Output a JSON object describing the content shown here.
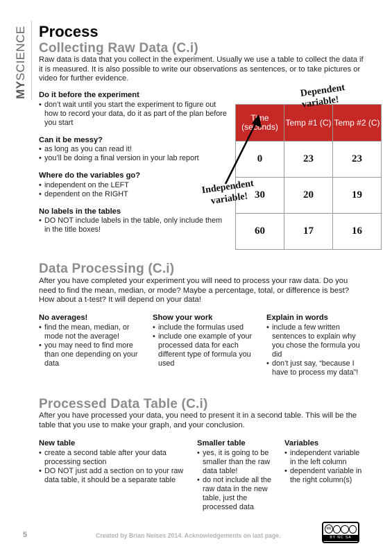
{
  "side_label": {
    "bold": "MY",
    "rest": "SCIENCE"
  },
  "page_title": "Process",
  "section1": {
    "title": "Collecting Raw Data (C.i)",
    "intro": "Raw data is data that you collect in the experiment.  Usually we use a table to collect the data if it is measured.  It is also possible to write our observations as sentences, or to take pictures or video for further evidence.",
    "blocks": [
      {
        "heading": "Do it before the experiment",
        "bullets": [
          "don’t wait until you start the experiment to figure out how to record your data, do it as part of the plan before you start"
        ]
      },
      {
        "heading": "Can it be messy?",
        "bullets": [
          "as long as you can read it!",
          "you’ll be doing a final version in your lab report"
        ]
      },
      {
        "heading": "Where do the variables go?",
        "bullets": [
          "independent on the LEFT",
          "dependent on the RIGHT"
        ]
      },
      {
        "heading": "No labels in the tables",
        "bullets": [
          "DO NOT include labels in the table, only include them in the title boxes!"
        ]
      }
    ],
    "table": {
      "headers": [
        "Time (seconds)",
        "Temp #1 (C)",
        "Temp #2 (C)"
      ],
      "rows": [
        [
          "0",
          "23",
          "23"
        ],
        [
          "30",
          "20",
          "19"
        ],
        [
          "60",
          "17",
          "16"
        ]
      ]
    },
    "annotations": {
      "dependent": "Dependent variable!",
      "independent": "Independent variable!"
    }
  },
  "section2": {
    "title": "Data Processing (C.i)",
    "intro": "After you have completed your experiment you will need to process your raw data.  Do you need to find the mean, median, or mode? Maybe a percentage, total, or difference is best? How about a t-test?  It will depend on your data!",
    "columns": [
      {
        "heading": "No averages!",
        "bullets": [
          "find the mean, median, or mode not the average!",
          "you may need to find more than one depending on your data"
        ]
      },
      {
        "heading": "Show your work",
        "bullets": [
          "include the formulas used",
          "include one example of your processed data for each different type of formula you used"
        ]
      },
      {
        "heading": "Explain in words",
        "bullets": [
          "include a few written sentences to explain why you chose the formula you did",
          "don’t just say, “because I have to process my data”!"
        ]
      }
    ]
  },
  "section3": {
    "title": "Processed Data Table (C.i)",
    "intro": "After you have processed your data, you need to present it in a second table.  This will be the table that you use to make your graph, and your conclusion.",
    "columns": [
      {
        "heading": "New table",
        "bullets": [
          "create a second table after your data processing section",
          "DO NOT just add a section on to your raw data table, it should be a separate table"
        ]
      },
      {
        "heading": "Smaller table",
        "bullets": [
          "yes, it is going to be smaller than the raw data table!",
          "do not include all the raw data in the new table, just the processed data"
        ]
      },
      {
        "heading": "Variables",
        "bullets": [
          "independent variable in the left column",
          "dependent variable in the right column(s)"
        ]
      }
    ]
  },
  "footer": {
    "page_number": "5",
    "credit": "Created by Brian Neises 2014.  Acknowledgements on last page.",
    "license": "BY NC SA"
  },
  "colors": {
    "table_header": "#c62826",
    "section_title": "#8c8c8c"
  }
}
